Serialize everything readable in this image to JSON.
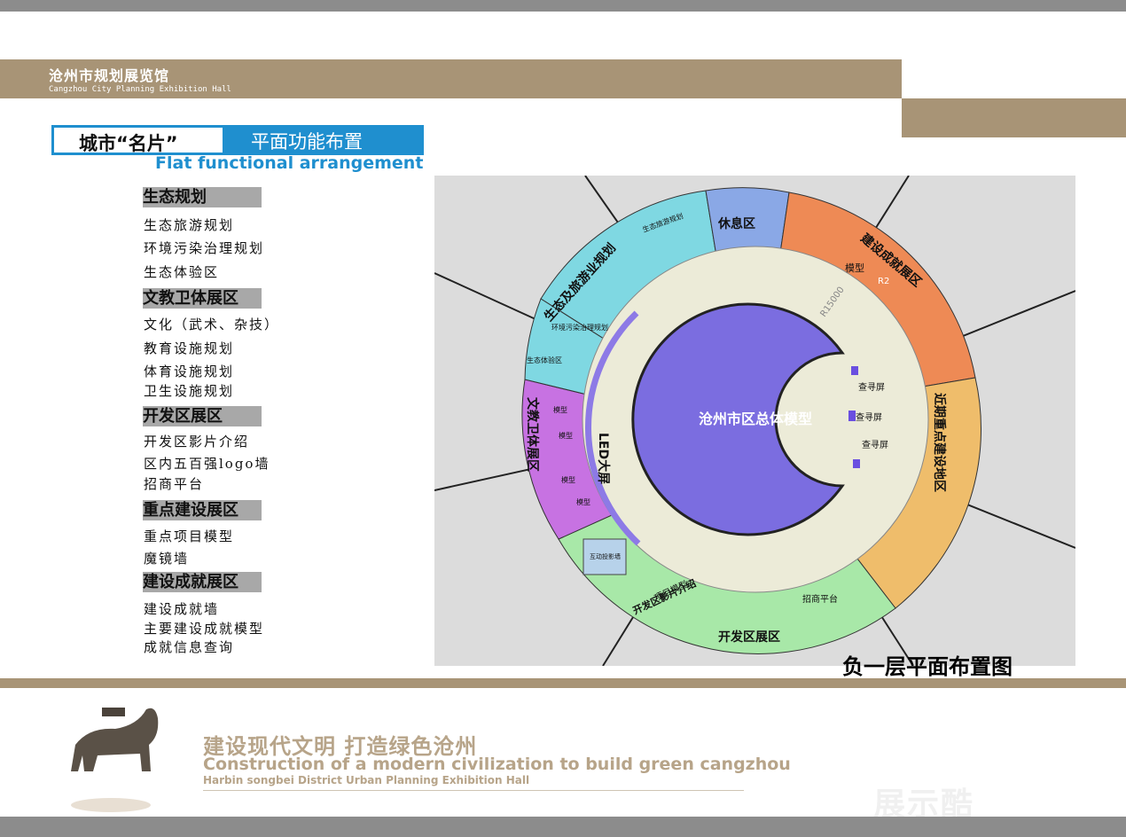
{
  "header": {
    "hall_cn": "沧州市规划展览馆",
    "hall_en": "Cangzhou City Planning Exhibition Hall"
  },
  "title": {
    "left": "城市“名片”",
    "right": "平面功能布置",
    "en": "Flat functional arrangement"
  },
  "sections": [
    {
      "heading": "生态规划",
      "items": [
        "生态旅游规划",
        "环境污染治理规划",
        "生态体验区"
      ]
    },
    {
      "heading": "文教卫体展区",
      "items": [
        "文化（武术、杂技）",
        "教育设施规划",
        "体育设施规划",
        "卫生设施规划"
      ]
    },
    {
      "heading": "开发区展区",
      "items": [
        "开发区影片介绍",
        "区内五百强logo墙",
        "招商平台"
      ]
    },
    {
      "heading": "重点建设展区",
      "items": [
        "重点项目模型",
        "魔镜墙"
      ]
    },
    {
      "heading": "建设成就展区",
      "items": [
        "建设成就墙",
        "主要建设成就模型",
        "成就信息查询"
      ]
    }
  ],
  "plan": {
    "caption": "负一层平面布置图",
    "center": "沧州市区总体模型",
    "led": "LED大屏",
    "query": "查寻屏",
    "rest": "休息区",
    "achievement": "建设成就展区",
    "model": "模型",
    "recent": "近期重点建设地区",
    "eco": "生态及旅游业规划",
    "eco_tour": "生态旅游规划",
    "env": "环境污染治理规划",
    "eco_exp": "生态体验区",
    "culture": "文教卫体展区",
    "dev": "开发区展区",
    "dev_film": "开发区影片介绍",
    "project": "项目模型",
    "investment": "招商平台",
    "interactive": "互动投影墙",
    "radius": "R15000",
    "r2": "R2"
  },
  "footer": {
    "cn": "建设现代文明  打造绿色沧州",
    "en1": "Construction of a modern civilization to build green cangzhou",
    "en2": "Harbin songbei District Urban Planning Exhibition Hall",
    "watermark": "展示酷"
  },
  "colors": {
    "band": "#a89476",
    "title_blue": "#1f8fcf",
    "eco": "#7fd8e2",
    "culture": "#c772e2",
    "dev": "#a8e8a8",
    "achievement": "#ee8a55",
    "recent": "#efbd6b",
    "rest": "#8aa8e6",
    "core": "#7b6de0"
  }
}
